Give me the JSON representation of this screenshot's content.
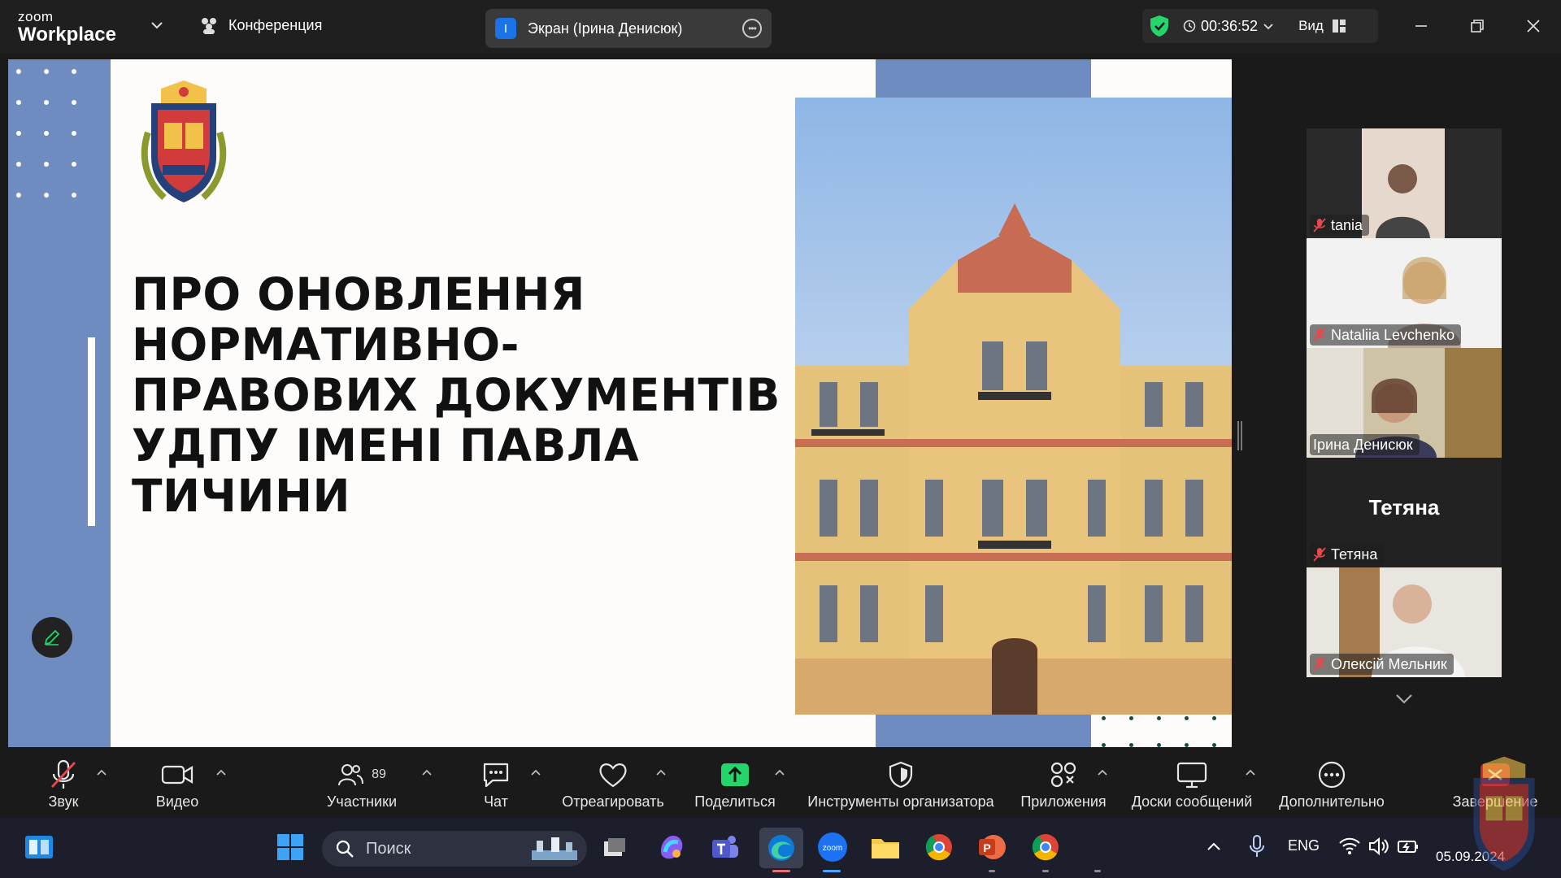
{
  "topbar": {
    "brand_small": "zoom",
    "brand_big": "Workplace",
    "meeting_label": "Конференция",
    "share_avatar_letter": "I",
    "share_label": "Экран (Ірина Денисюк)",
    "timer": "00:36:52",
    "view_label": "Вид"
  },
  "slide": {
    "title": "ПРО ОНОВЛЕННЯ НОРМАТИВНО-ПРАВОВИХ ДОКУМЕНТІВ УДПУ ІМЕНІ ПАВЛА ТИЧИНИ"
  },
  "participants": [
    {
      "name": "tania",
      "muted": true,
      "video": true
    },
    {
      "name": "Nataliia Levchenko",
      "muted": true,
      "video": true
    },
    {
      "name": "Ірина Денисюк",
      "muted": false,
      "video": true,
      "active": true
    },
    {
      "name": "Тетяна",
      "display_name": "Тетяна",
      "muted": true,
      "video": false
    },
    {
      "name": "Олексій Мельник",
      "muted": true,
      "video": true
    }
  ],
  "toolbar": {
    "audio": "Звук",
    "video": "Видео",
    "participants": "Участники",
    "participants_count": "89",
    "chat": "Чат",
    "react": "Отреагировать",
    "share": "Поделиться",
    "host_tools": "Инструменты организатора",
    "apps": "Приложения",
    "whiteboards": "Доски сообщений",
    "more": "Дополнительно",
    "end": "Завершение"
  },
  "taskbar": {
    "search_placeholder": "Поиск",
    "language": "ENG",
    "date": "05.09.2024"
  },
  "colors": {
    "slide_blue": "#6e8cc0",
    "active_speaker": "#23d56b",
    "share_green": "#23d56b",
    "muted_red": "#e5484d"
  }
}
